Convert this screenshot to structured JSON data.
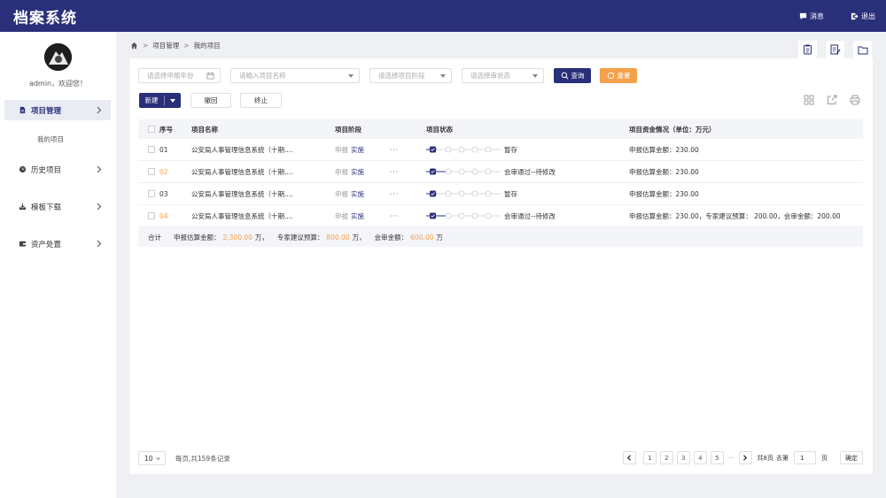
{
  "header": {
    "app_title": "档案系统",
    "message_label": "消息",
    "logout_label": "退出"
  },
  "sidebar": {
    "welcome": "admin，欢迎您！",
    "items": [
      {
        "label": "项目管理",
        "icon": "file-icon",
        "active": true
      },
      {
        "label": "历史项目",
        "icon": "clock-icon",
        "active": false
      },
      {
        "label": "模板下载",
        "icon": "download-icon",
        "active": false
      },
      {
        "label": "资产处置",
        "icon": "wallet-icon",
        "active": false
      }
    ],
    "sub_items": [
      {
        "label": "我的项目"
      }
    ]
  },
  "breadcrumb": {
    "items": [
      "项目管理",
      "我的项目"
    ]
  },
  "filters": {
    "year_placeholder": "请选择申报年份",
    "name_placeholder": "请输入项目名称",
    "stage_placeholder": "请选择项目阶段",
    "status_placeholder": "请选择审状态",
    "search_label": "查询",
    "reset_label": "重置"
  },
  "toolbar": {
    "new_label": "新建",
    "withdraw_label": "撤回",
    "terminate_label": "终止"
  },
  "table": {
    "columns": [
      "序号",
      "项目名称",
      "项目阶段",
      "项目状态",
      "项目资金情况（单位：万元）"
    ],
    "rows": [
      {
        "seq": "01",
        "name": "公安局人事管理信息系统（十期....",
        "stage_prev": "申报",
        "stage_cur": "实施",
        "status": "暂存",
        "funds": "申报估算金额：230.00",
        "seq_orange": false
      },
      {
        "seq": "02",
        "name": "公安局人事管理信息系统（十期....",
        "stage_prev": "申报",
        "stage_cur": "实施",
        "status": "会审通过--待修改",
        "funds": "申报估算金额：230.00",
        "seq_orange": true
      },
      {
        "seq": "03",
        "name": "公安局人事管理信息系统（十期....",
        "stage_prev": "申报",
        "stage_cur": "实施",
        "status": "暂存",
        "funds": "申报估算金额：230.00",
        "seq_orange": false
      },
      {
        "seq": "04",
        "name": "公安局人事管理信息系统（十期....",
        "stage_prev": "申报",
        "stage_cur": "实施",
        "status": "会审通过--待修改",
        "funds": "申报估算金额：230.00，专家建议预算： 200.00，会审金额：200.00",
        "seq_orange": true
      }
    ],
    "more_label": "···",
    "total": {
      "label": "合计",
      "apply_label": "申报估算金额：",
      "apply_value": "2,300.00",
      "apply_unit": "万，",
      "expert_label": "专家建议预算：",
      "expert_value": "800.00",
      "expert_unit": "万，",
      "review_label": "会审金额：",
      "review_value": "600.00",
      "review_unit": "万"
    }
  },
  "pagination": {
    "page_size": "10",
    "info": "每页,共159条记录",
    "pages": [
      "1",
      "2",
      "3",
      "4",
      "5"
    ],
    "ellipsis": "···",
    "total_pages": "共8页",
    "goto_label": "去第",
    "goto_value": "1",
    "page_unit": "页",
    "confirm_label": "确定"
  },
  "colors": {
    "brand": "#2a2f7a",
    "accent": "#f5a04a"
  }
}
